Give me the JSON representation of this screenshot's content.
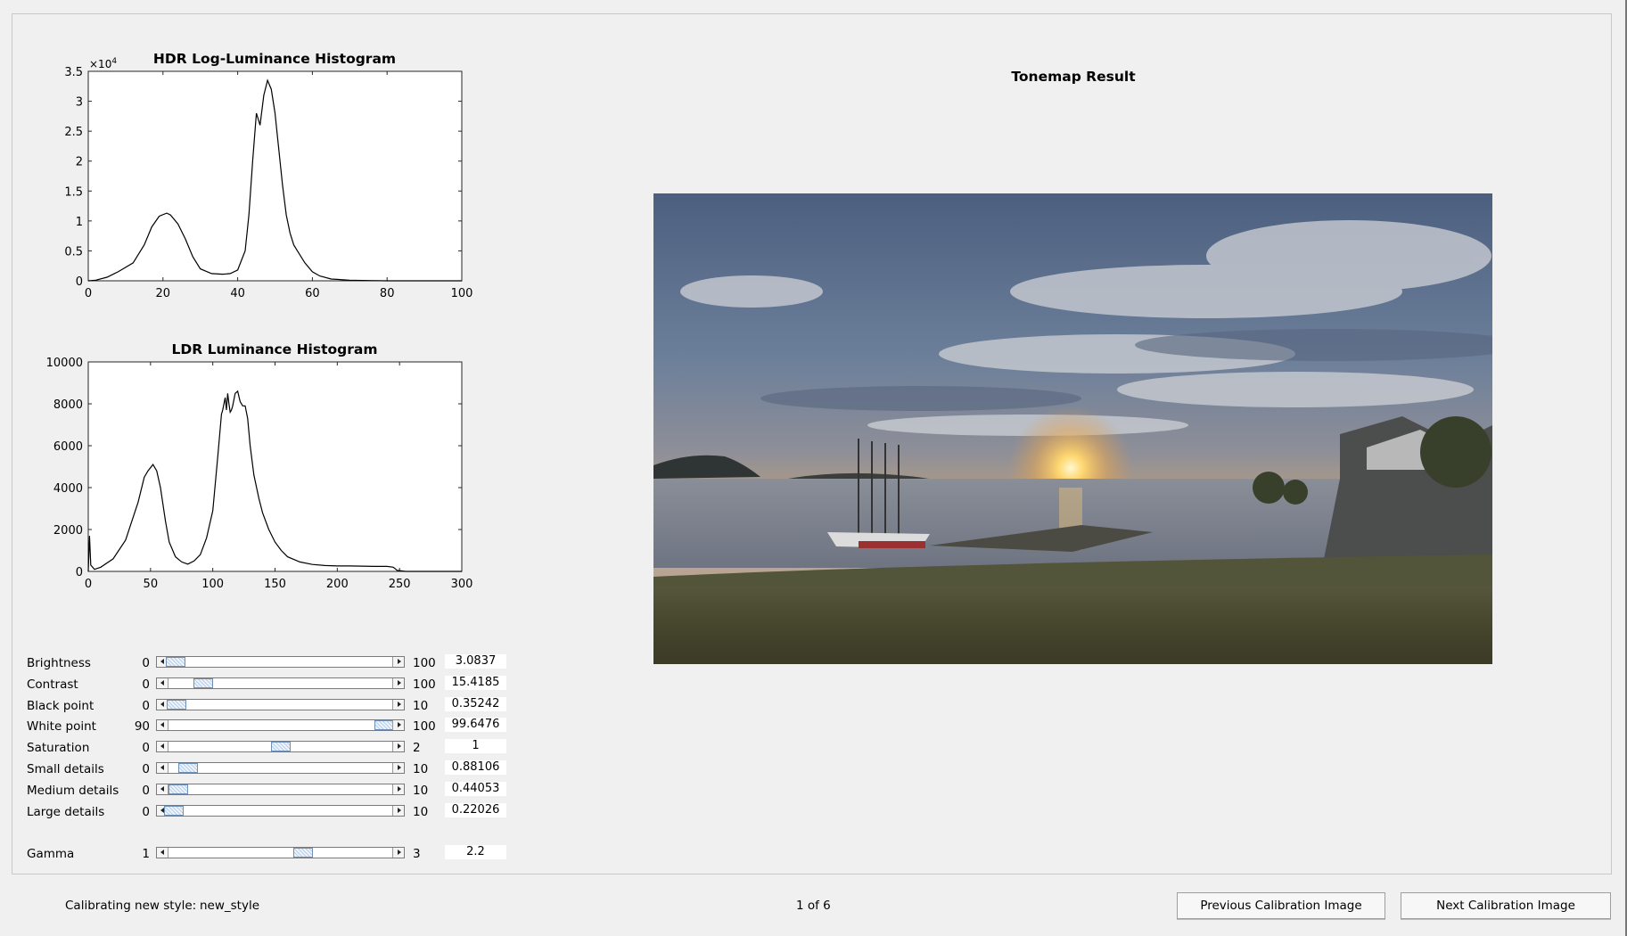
{
  "histograms": {
    "hdr": {
      "title": "HDR Log-Luminance Histogram",
      "exponent_label": "×10",
      "exponent_sup": "4",
      "x_ticks": [
        "0",
        "20",
        "40",
        "60",
        "80",
        "100"
      ],
      "y_ticks": [
        "0",
        "0.5",
        "1",
        "1.5",
        "2",
        "2.5",
        "3",
        "3.5"
      ]
    },
    "ldr": {
      "title": "LDR Luminance Histogram",
      "x_ticks": [
        "0",
        "50",
        "100",
        "150",
        "200",
        "250",
        "300"
      ],
      "y_ticks": [
        "0",
        "2000",
        "4000",
        "6000",
        "8000",
        "10000"
      ]
    }
  },
  "chart_data": [
    {
      "type": "line",
      "title": "HDR Log-Luminance Histogram",
      "xlim": [
        0,
        100
      ],
      "ylim": [
        0,
        3.5
      ],
      "y_scale_factor": "×10^4",
      "grid": false,
      "series": [
        {
          "x": [
            0,
            2,
            5,
            8,
            12,
            15,
            17,
            19,
            21,
            22,
            24,
            26,
            28,
            30,
            33,
            36,
            38,
            40,
            42,
            43,
            44,
            45,
            46,
            47,
            48,
            49,
            50,
            51,
            52,
            53,
            54,
            55,
            56,
            58,
            60,
            62,
            65,
            70,
            75,
            80,
            90,
            100
          ],
          "y": [
            0,
            0.01,
            0.06,
            0.15,
            0.3,
            0.6,
            0.9,
            1.08,
            1.13,
            1.1,
            0.95,
            0.7,
            0.4,
            0.2,
            0.12,
            0.11,
            0.12,
            0.18,
            0.5,
            1.1,
            2.0,
            2.8,
            2.6,
            3.1,
            3.35,
            3.2,
            2.8,
            2.2,
            1.6,
            1.1,
            0.8,
            0.6,
            0.5,
            0.3,
            0.15,
            0.08,
            0.03,
            0.01,
            0.005,
            0,
            0,
            0
          ]
        }
      ]
    },
    {
      "type": "line",
      "title": "LDR Luminance Histogram",
      "xlim": [
        0,
        300
      ],
      "ylim": [
        0,
        10000
      ],
      "grid": false,
      "series": [
        {
          "x": [
            0,
            1,
            2,
            5,
            10,
            20,
            30,
            35,
            40,
            45,
            48,
            52,
            55,
            58,
            62,
            65,
            70,
            75,
            80,
            85,
            90,
            95,
            100,
            104,
            107,
            108,
            110,
            111,
            112,
            113,
            114,
            115,
            116,
            118,
            120,
            122,
            124,
            126,
            128,
            130,
            133,
            137,
            140,
            145,
            150,
            155,
            160,
            170,
            180,
            190,
            200,
            210,
            220,
            230,
            240,
            245,
            248,
            252,
            255,
            260,
            300
          ],
          "y": [
            0,
            1700,
            300,
            100,
            200,
            600,
            1500,
            2400,
            3300,
            4500,
            4800,
            5100,
            4800,
            4000,
            2400,
            1400,
            700,
            450,
            350,
            500,
            800,
            1600,
            2900,
            5500,
            7500,
            7700,
            8300,
            7700,
            8500,
            8000,
            7600,
            7700,
            7900,
            8500,
            8600,
            8100,
            7900,
            7900,
            7300,
            6000,
            4600,
            3500,
            2800,
            2000,
            1400,
            1000,
            700,
            450,
            330,
            280,
            260,
            260,
            250,
            240,
            240,
            200,
            50,
            20,
            0,
            0,
            0
          ]
        }
      ]
    }
  ],
  "result": {
    "title": "Tonemap Result"
  },
  "sliders": [
    {
      "label": "Brightness",
      "min": "0",
      "max": "100",
      "value": "3.0837",
      "frac": 0.0308
    },
    {
      "label": "Contrast",
      "min": "0",
      "max": "100",
      "value": "15.4185",
      "frac": 0.154
    },
    {
      "label": "Black point",
      "min": "0",
      "max": "10",
      "value": "0.35242",
      "frac": 0.035
    },
    {
      "label": "White point",
      "min": "90",
      "max": "100",
      "value": "99.6476",
      "frac": 0.965
    },
    {
      "label": "Saturation",
      "min": "0",
      "max": "2",
      "value": "1",
      "frac": 0.5
    },
    {
      "label": "Small details",
      "min": "0",
      "max": "10",
      "value": "0.88106",
      "frac": 0.088
    },
    {
      "label": "Medium details",
      "min": "0",
      "max": "10",
      "value": "0.44053",
      "frac": 0.044
    },
    {
      "label": "Large details",
      "min": "0",
      "max": "10",
      "value": "0.22026",
      "frac": 0.022
    }
  ],
  "gamma": {
    "label": "Gamma",
    "min": "1",
    "max": "3",
    "value": "2.2",
    "frac": 0.6
  },
  "footer": {
    "calibrating_label": "Calibrating new style:",
    "style_name": "new_style",
    "page_indicator": "1 of 6",
    "prev_button": "Previous Calibration Image",
    "next_button": "Next Calibration Image"
  },
  "colors": {
    "background": "#f0f0f0",
    "plot_line": "#000000",
    "thumb": "#b8cde6"
  }
}
